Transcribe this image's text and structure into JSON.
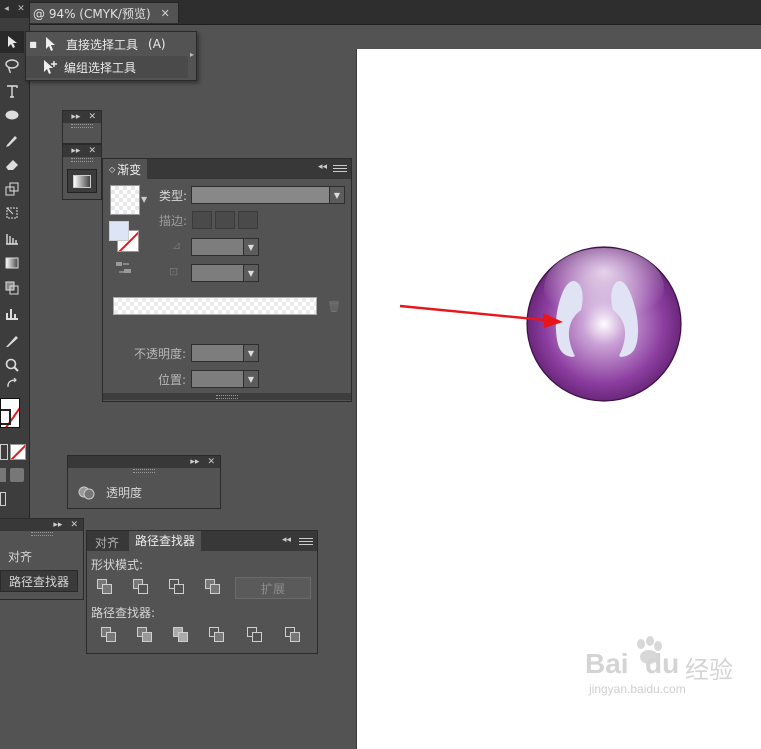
{
  "document_tab": {
    "title": "@ 94% (CMYK/预览)",
    "close_glyph": "✕"
  },
  "toolbar": {
    "header_arrows": "◂",
    "header_close": "✕"
  },
  "flyout": {
    "items": [
      {
        "label": "直接选择工具",
        "shortcut": "(A)",
        "bullet": "■"
      },
      {
        "label": "编组选择工具"
      }
    ],
    "arrow": "▸"
  },
  "mini_panels": {
    "expand_glyph": "▸▸",
    "close_glyph": "✕"
  },
  "gradient_panel": {
    "tab_label": "渐变",
    "tab_prefix": "◇",
    "menu_glyph": "◂◂",
    "type_label": "类型:",
    "stroke_label": "描边:",
    "opacity_label": "不透明度:",
    "location_label": "位置:",
    "trash_glyph": "🗑"
  },
  "transparency_panel": {
    "label": "透明度"
  },
  "align_collapsed_panel": {
    "items": [
      {
        "label": "对齐"
      },
      {
        "label": "路径查找器"
      }
    ]
  },
  "pathfinder_panel": {
    "tabs": [
      {
        "label": "对齐"
      },
      {
        "label": "路径查找器"
      }
    ],
    "shape_modes_label": "形状模式:",
    "expand_label": "扩展",
    "pathfinders_label": "路径查找器:"
  },
  "watermark": {
    "brand": "Bai",
    "brand2": "du",
    "brand_cn": "经验",
    "url": "jingyan.baidu.com"
  },
  "colors": {
    "sphere_purple": "#7e2f8e",
    "arrow_red": "#e8151b",
    "ui_bg": "#535353",
    "panel_dark": "#383838"
  }
}
